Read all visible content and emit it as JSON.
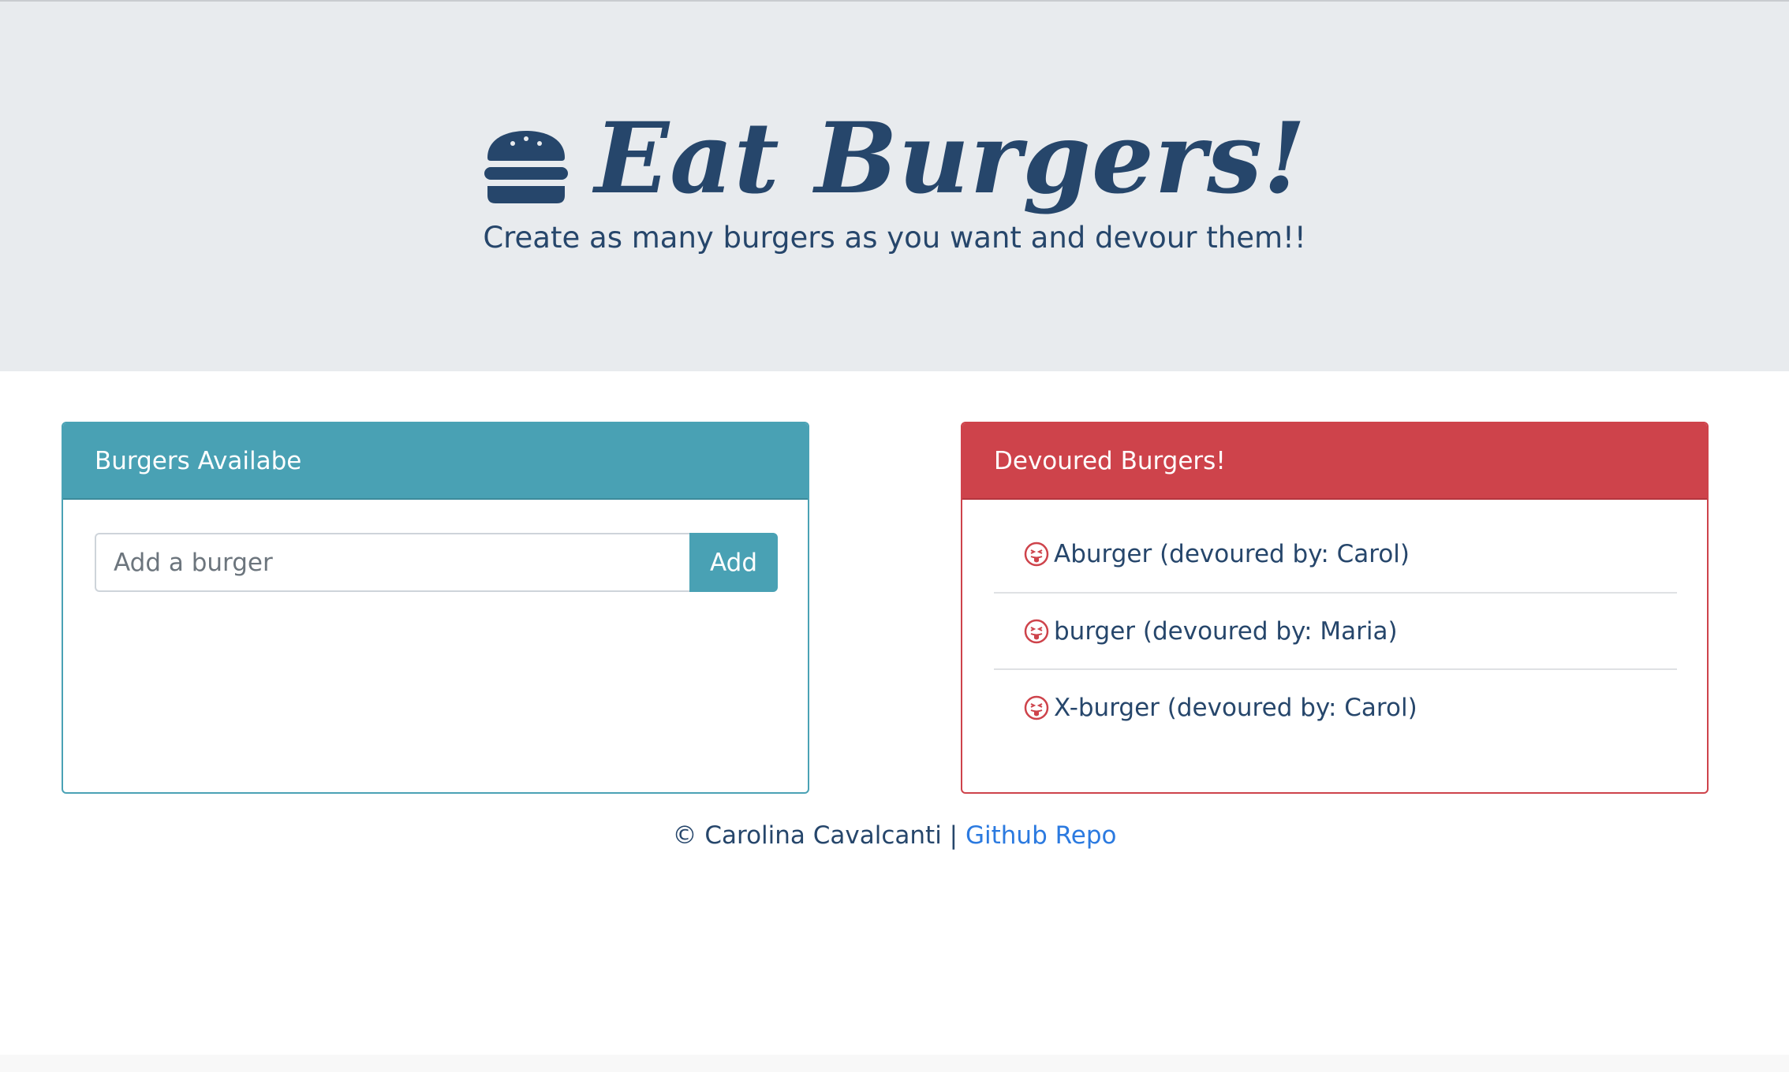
{
  "header": {
    "icon": "hamburger-icon",
    "title": "Eat Burgers!",
    "subtitle": "Create as many burgers as you want and devour them!!"
  },
  "available_card": {
    "title": "Burgers Availabe",
    "input_placeholder": "Add a burger",
    "input_value": "",
    "add_label": "Add"
  },
  "devoured_card": {
    "title": "Devoured Burgers!",
    "item_icon": "tongue-face-icon",
    "items": [
      {
        "label": "Aburger (devoured by: Carol)"
      },
      {
        "label": "burger (devoured by: Maria)"
      },
      {
        "label": "X-burger (devoured by: Carol)"
      }
    ]
  },
  "footer": {
    "copyright": "© Carolina Cavalcanti | ",
    "link_label": "Github Repo"
  },
  "colors": {
    "primary_text": "#26466b",
    "jumbotron_bg": "#e8ebee",
    "info": "#49a1b4",
    "danger": "#ce434b",
    "link": "#2b7ae0"
  }
}
